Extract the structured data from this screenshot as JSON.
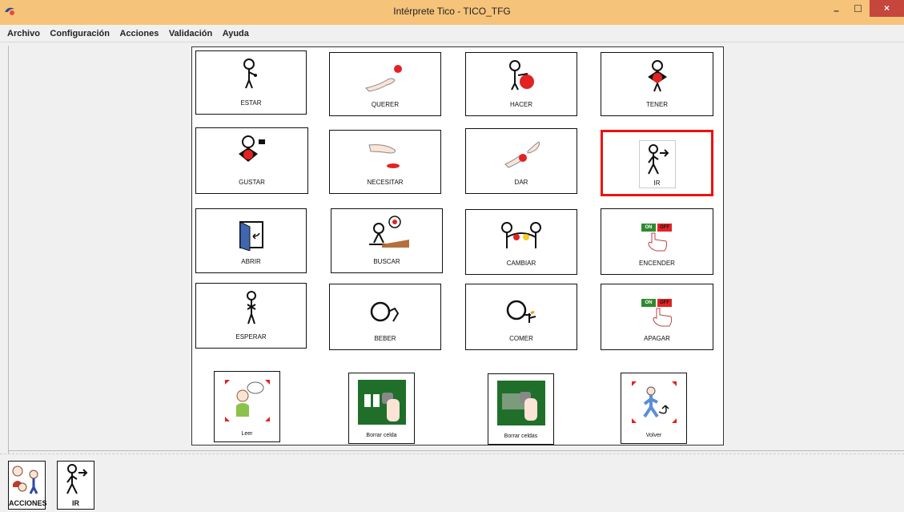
{
  "window": {
    "title": "Intérprete Tico - TICO_TFG",
    "minimize": "–",
    "maximize": "☐",
    "close": "×"
  },
  "menu": [
    "Archivo",
    "Configuración",
    "Acciones",
    "Validación",
    "Ayuda"
  ],
  "board": {
    "rows": [
      [
        "ESTAR",
        "QUERER",
        "HACER",
        "TENER"
      ],
      [
        "GUSTAR",
        "NECESITAR",
        "DAR",
        "IR"
      ],
      [
        "ABRIR",
        "BUSCAR",
        "CAMBIAR",
        "ENCENDER"
      ],
      [
        "ESPERAR",
        "BEBER",
        "COMER",
        "APAGAR"
      ]
    ],
    "selected": "IR",
    "bottom_buttons": [
      "Leer",
      "Borrar celda",
      "Borrar celdas",
      "Volver"
    ]
  },
  "history": [
    "ACCIONES",
    "IR"
  ],
  "colors": {
    "titlebar": "#f6c37a",
    "selection": "#ee1111",
    "close": "#c7463c",
    "green": "#1f6f2a",
    "red": "#e32222"
  },
  "icons": {
    "on": "ON",
    "off": "OFF"
  }
}
